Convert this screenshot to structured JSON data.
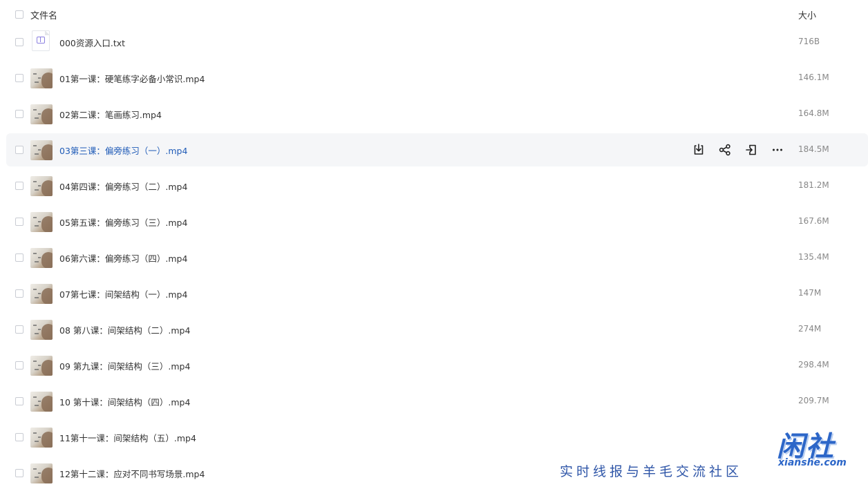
{
  "header": {
    "name_label": "文件名",
    "size_label": "大小"
  },
  "files": [
    {
      "name": "000资源入口.txt",
      "size": "716B",
      "type": "txt"
    },
    {
      "name": "01第一课：硬笔练字必备小常识.mp4",
      "size": "146.1M",
      "type": "video"
    },
    {
      "name": "02第二课：笔画练习.mp4",
      "size": "164.8M",
      "type": "video"
    },
    {
      "name": "03第三课：偏旁练习（一）.mp4",
      "size": "184.5M",
      "type": "video",
      "hovered": true
    },
    {
      "name": "04第四课：偏旁练习（二）.mp4",
      "size": "181.2M",
      "type": "video"
    },
    {
      "name": "05第五课：偏旁练习（三）.mp4",
      "size": "167.6M",
      "type": "video"
    },
    {
      "name": "06第六课：偏旁练习（四）.mp4",
      "size": "135.4M",
      "type": "video"
    },
    {
      "name": "07第七课：间架结构（一）.mp4",
      "size": "147M",
      "type": "video"
    },
    {
      "name": "08 第八课：间架结构（二）.mp4",
      "size": "274M",
      "type": "video"
    },
    {
      "name": "09 第九课：间架结构（三）.mp4",
      "size": "298.4M",
      "type": "video"
    },
    {
      "name": "10 第十课：间架结构（四）.mp4",
      "size": "209.7M",
      "type": "video"
    },
    {
      "name": "11第十一课：间架结构（五）.mp4",
      "size": "",
      "type": "video"
    },
    {
      "name": "12第十二课：应对不同书写场景.mp4",
      "size": "",
      "type": "video"
    }
  ],
  "row_actions": [
    "download-icon",
    "share-icon",
    "move-icon",
    "more-icon"
  ],
  "watermark": {
    "slogan": "实时线报与羊毛交流社区",
    "logo_cn": "闲社",
    "logo_en": "xianshe.com"
  },
  "colors": {
    "hover_bg": "#f5f6f8",
    "link_blue": "#1f5bb7",
    "watermark_blue": "#2f56a8"
  }
}
